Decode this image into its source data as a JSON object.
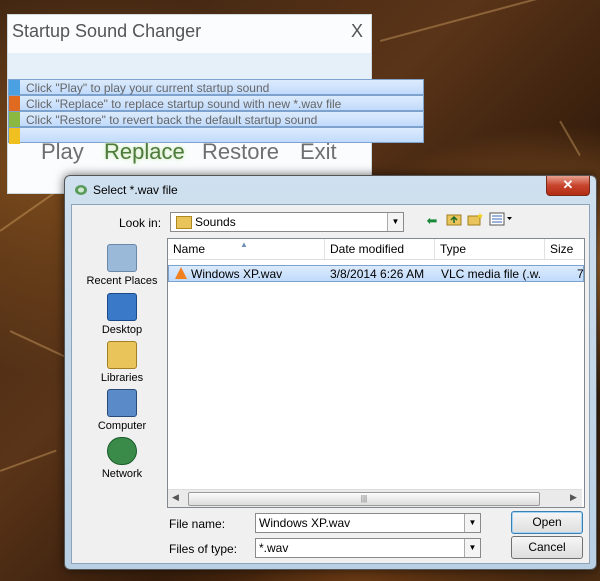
{
  "app": {
    "title": "Startup Sound Changer",
    "close_label": "X",
    "help_lines": [
      {
        "text": "Click \"Play\" to play your current startup sound",
        "color": "#4aa0e0"
      },
      {
        "text": "Click \"Replace\" to replace startup sound with new *.wav file",
        "color": "#e06a20"
      },
      {
        "text": "Click \"Restore\" to revert back the default startup sound",
        "color": "#8ab840"
      }
    ],
    "extra_bar_color": "#f0c020",
    "buttons": {
      "play": "Play",
      "replace": "Replace",
      "restore": "Restore",
      "exit": "Exit"
    }
  },
  "dialog": {
    "title": "Select *.wav file",
    "close_label": "✕",
    "look_in_label": "Look in:",
    "look_in_value": "Sounds",
    "toolbar_icons": [
      "back-icon",
      "up-folder-icon",
      "new-folder-icon",
      "view-menu-icon"
    ],
    "places": [
      {
        "label": "Recent Places",
        "icon": "recent-places-icon",
        "color": "#9ab8d8"
      },
      {
        "label": "Desktop",
        "icon": "desktop-icon",
        "color": "#3a78c8"
      },
      {
        "label": "Libraries",
        "icon": "libraries-icon",
        "color": "#e8c45a"
      },
      {
        "label": "Computer",
        "icon": "computer-icon",
        "color": "#5a8ac8"
      },
      {
        "label": "Network",
        "icon": "network-icon",
        "color": "#3a8a4a"
      }
    ],
    "columns": [
      "Name",
      "Date modified",
      "Type",
      "Size"
    ],
    "files": [
      {
        "name": "Windows XP.wav",
        "date": "3/8/2014 6:26 AM",
        "type": "VLC media file (.w...",
        "size": "7"
      }
    ],
    "file_name_label": "File name:",
    "file_name_value": "Windows XP.wav",
    "files_of_type_label": "Files of type:",
    "files_of_type_value": "*.wav",
    "open_label": "Open",
    "cancel_label": "Cancel"
  }
}
